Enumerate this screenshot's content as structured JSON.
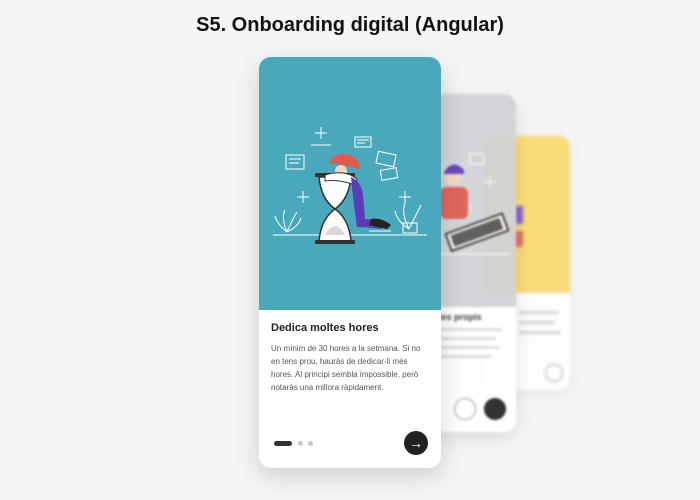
{
  "page": {
    "title": "S5. Onboarding digital (Angular)"
  },
  "colors": {
    "card1_illustration_bg": "#4aa8bd",
    "card2_illustration_bg": "#d2d3d7",
    "card3_illustration_bg": "#fcd863",
    "accent_dark": "#222222",
    "person_hair": "#e05a4f",
    "person_pants": "#5b3bb8"
  },
  "cards": [
    {
      "title": "Dedica moltes hores",
      "body": "Un mínim de 30 hores a la setmana. Si no en tens prou, hauràs de dedicar-li més hores. Al principi sembla impossible, però notaràs una millora ràpidament.",
      "illustration_icon": "hourglass-person-illustration",
      "next_label": "→"
    },
    {
      "title": "ltes propis",
      "illustration_icon": "person-laptop-illustration"
    },
    {
      "illustration_icon": "person-illustration"
    }
  ],
  "pagination": {
    "total": 3,
    "current": 1
  }
}
